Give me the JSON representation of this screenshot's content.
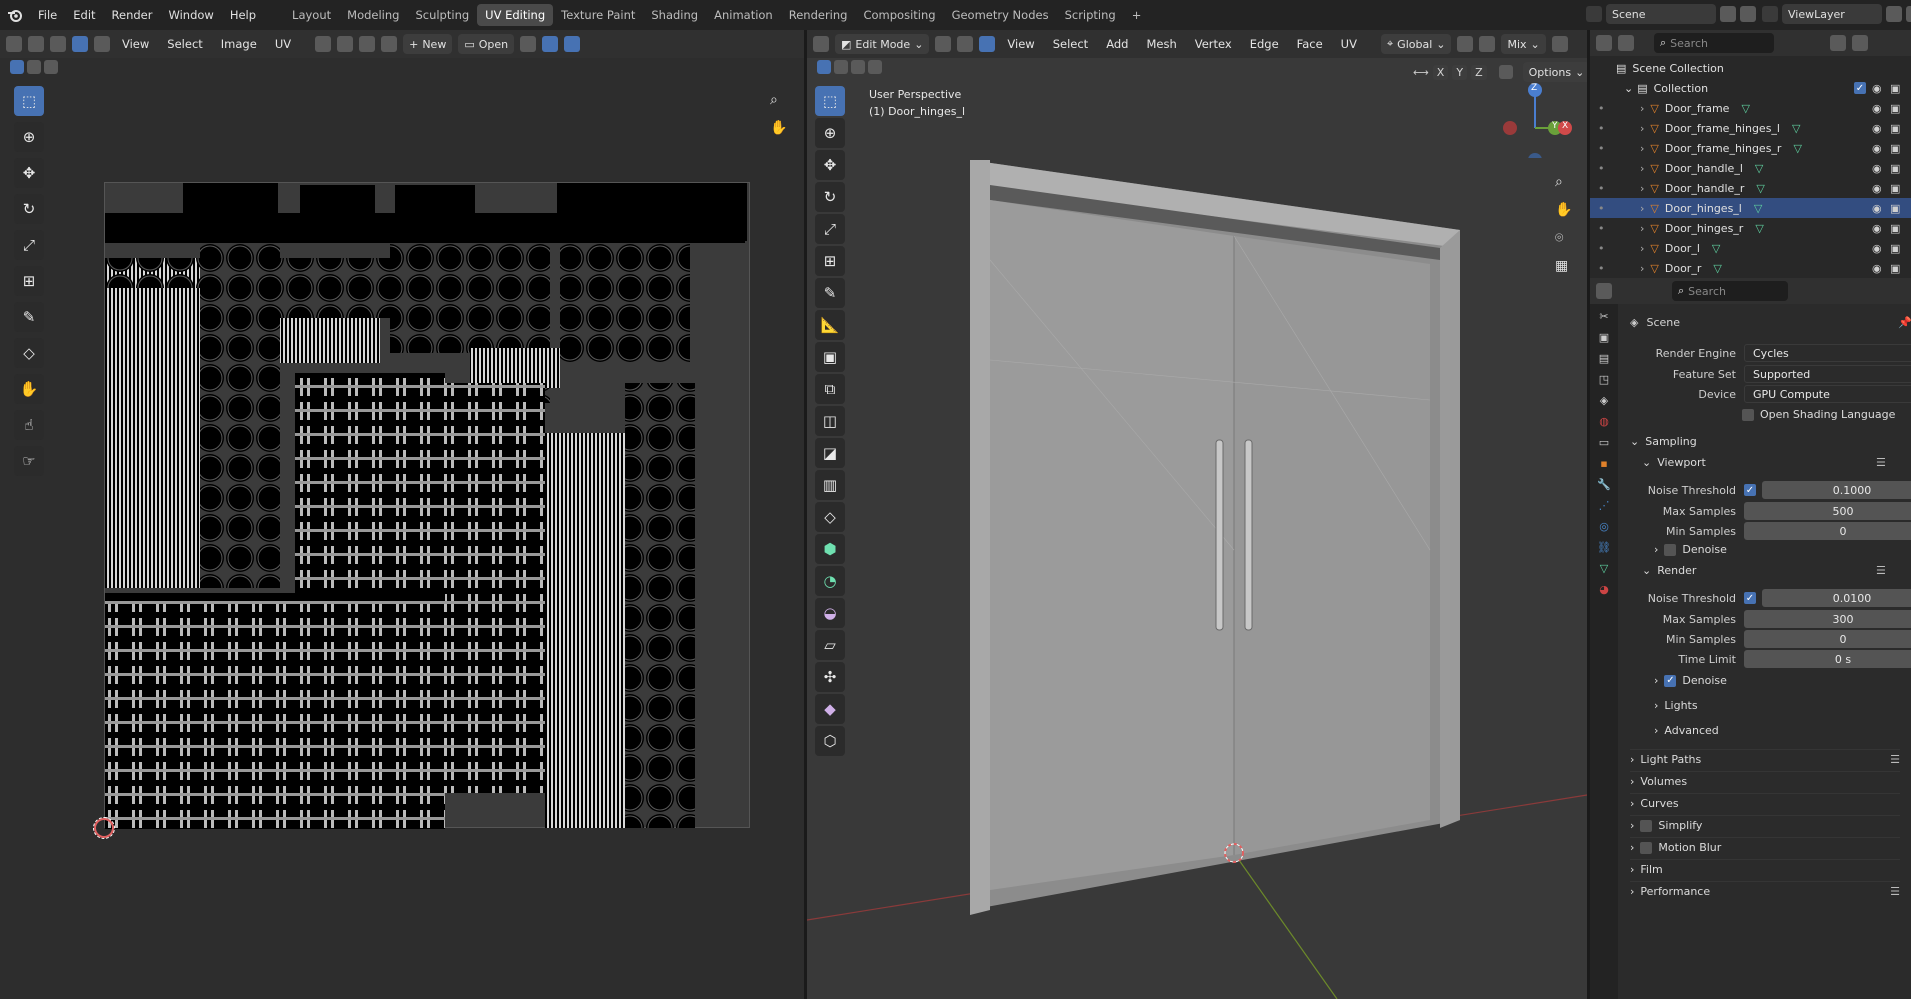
{
  "topbar": {
    "menus": [
      "File",
      "Edit",
      "Render",
      "Window",
      "Help"
    ],
    "workspaces": [
      "Layout",
      "Modeling",
      "Sculpting",
      "UV Editing",
      "Texture Paint",
      "Shading",
      "Animation",
      "Rendering",
      "Compositing",
      "Geometry Nodes",
      "Scripting"
    ],
    "active_workspace": "UV Editing",
    "add_tab": "+",
    "scene": "Scene",
    "view_layer": "ViewLayer"
  },
  "uv_editor": {
    "menus": [
      "View",
      "Select",
      "Image",
      "UV"
    ],
    "new_label": "New",
    "open_label": "Open"
  },
  "viewport": {
    "mode": "Edit Mode",
    "menus": [
      "View",
      "Select",
      "Add",
      "Mesh",
      "Vertex",
      "Edge",
      "Face",
      "UV"
    ],
    "orientation": "Global",
    "shading_mix": "Mix",
    "options_label": "Options",
    "axes": [
      "X",
      "Y",
      "Z"
    ],
    "info_title": "User Perspective",
    "info_object": "(1) Door_hinges_l",
    "gizmo": {
      "z": "Z",
      "y": "Y",
      "x": "X"
    }
  },
  "outliner": {
    "search_placeholder": "Search",
    "scene_collection": "Scene Collection",
    "collection": "Collection",
    "items": [
      {
        "name": "Door_frame",
        "selected": false
      },
      {
        "name": "Door_frame_hinges_l",
        "selected": false
      },
      {
        "name": "Door_frame_hinges_r",
        "selected": false
      },
      {
        "name": "Door_handle_l",
        "selected": false
      },
      {
        "name": "Door_handle_r",
        "selected": false
      },
      {
        "name": "Door_hinges_l",
        "selected": true
      },
      {
        "name": "Door_hinges_r",
        "selected": false
      },
      {
        "name": "Door_l",
        "selected": false
      },
      {
        "name": "Door_r",
        "selected": false
      }
    ]
  },
  "properties": {
    "search_placeholder": "Search",
    "scene_label": "Scene",
    "render_engine": {
      "label": "Render Engine",
      "value": "Cycles"
    },
    "feature_set": {
      "label": "Feature Set",
      "value": "Supported"
    },
    "device": {
      "label": "Device",
      "value": "GPU Compute"
    },
    "osl": "Open Shading Language",
    "sampling": "Sampling",
    "viewport_section": "Viewport",
    "vp_noise_threshold": {
      "label": "Noise Threshold",
      "value": "0.1000"
    },
    "vp_max_samples": {
      "label": "Max Samples",
      "value": "500"
    },
    "vp_min_samples": {
      "label": "Min Samples",
      "value": "0"
    },
    "vp_denoise": "Denoise",
    "render_section": "Render",
    "r_noise_threshold": {
      "label": "Noise Threshold",
      "value": "0.0100"
    },
    "r_max_samples": {
      "label": "Max Samples",
      "value": "300"
    },
    "r_min_samples": {
      "label": "Min Samples",
      "value": "0"
    },
    "r_time_limit": {
      "label": "Time Limit",
      "value": "0 s"
    },
    "r_denoise": "Denoise",
    "lights": "Lights",
    "advanced": "Advanced",
    "panels": [
      "Light Paths",
      "Volumes",
      "Curves",
      "Simplify",
      "Motion Blur",
      "Film",
      "Performance"
    ]
  },
  "colors": {
    "accent": "#4772b3",
    "selection": "#334d80",
    "mesh_icon": "#e0812a",
    "vert_icon": "#5fd1a0"
  }
}
